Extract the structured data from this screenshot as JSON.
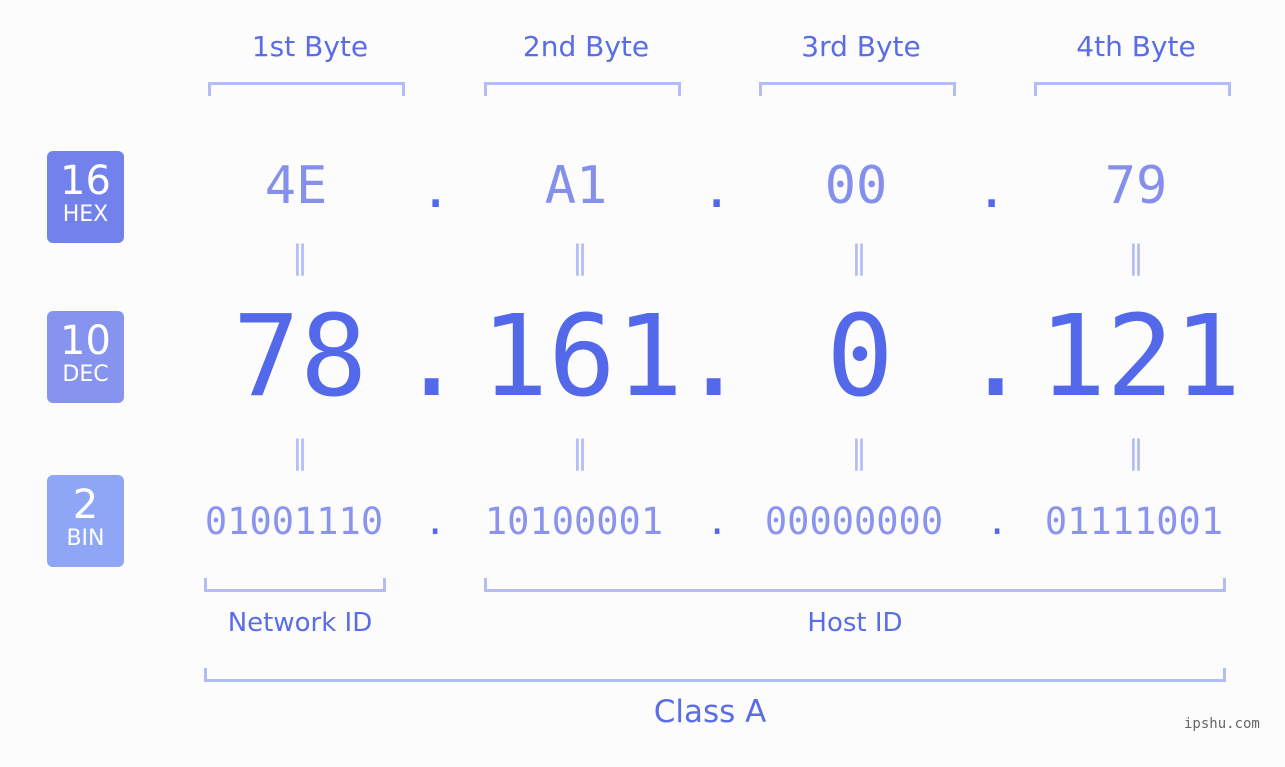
{
  "bytes": [
    {
      "label": "1st Byte",
      "hex": "4E",
      "dec": "78",
      "bin": "01001110"
    },
    {
      "label": "2nd Byte",
      "hex": "A1",
      "dec": "161",
      "bin": "10100001"
    },
    {
      "label": "3rd Byte",
      "hex": "00",
      "dec": "0",
      "bin": "00000000"
    },
    {
      "label": "4th Byte",
      "hex": "79",
      "dec": "121",
      "bin": "01111001"
    }
  ],
  "badges": {
    "hex": {
      "base": "16",
      "name": "HEX",
      "color": "#7281ec"
    },
    "dec": {
      "base": "10",
      "name": "DEC",
      "color": "#8694f0"
    },
    "bin": {
      "base": "2",
      "name": "BIN",
      "color": "#8fa6f6"
    }
  },
  "separator": ".",
  "equals": "=",
  "network_id_label": "Network ID",
  "host_id_label": "Host ID",
  "class_label": "Class A",
  "watermark": "ipshu.com"
}
